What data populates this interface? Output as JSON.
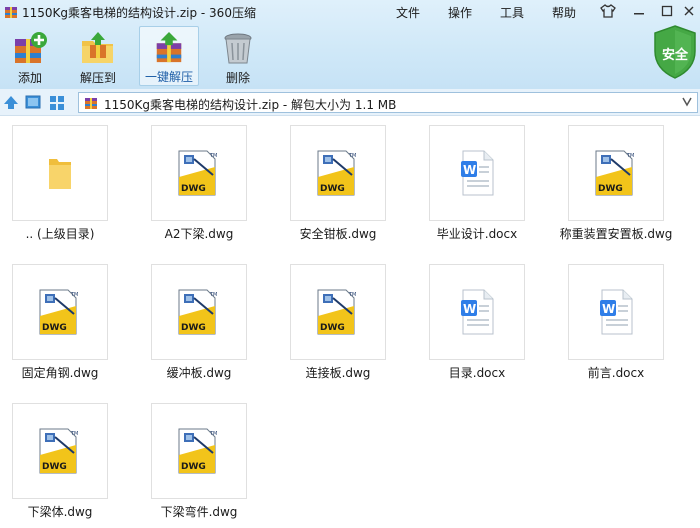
{
  "window": {
    "title": "1150Kg乘客电梯的结构设计.zip - 360压缩",
    "menus": [
      "文件",
      "操作",
      "工具",
      "帮助"
    ]
  },
  "toolbar": {
    "buttons": [
      {
        "label": "添加",
        "icon": "add-archive-icon"
      },
      {
        "label": "解压到",
        "icon": "extract-to-icon"
      },
      {
        "label": "一键解压",
        "icon": "one-click-extract-icon",
        "active": true
      },
      {
        "label": "删除",
        "icon": "trash-can-icon"
      }
    ],
    "security_badge": "安全"
  },
  "address": {
    "path": "1150Kg乘客电梯的结构设计.zip - 解包大小为 1.1 MB"
  },
  "files": [
    {
      "name": ".. (上级目录)",
      "type": "folder"
    },
    {
      "name": "A2下梁.dwg",
      "type": "dwg"
    },
    {
      "name": "安全钳板.dwg",
      "type": "dwg"
    },
    {
      "name": "毕业设计.docx",
      "type": "docx"
    },
    {
      "name": "称重装置安置板.dwg",
      "type": "dwg"
    },
    {
      "name": "固定角钢.dwg",
      "type": "dwg"
    },
    {
      "name": "缓冲板.dwg",
      "type": "dwg"
    },
    {
      "name": "连接板.dwg",
      "type": "dwg"
    },
    {
      "name": "目录.docx",
      "type": "docx"
    },
    {
      "name": "前言.docx",
      "type": "docx"
    },
    {
      "name": "下梁体.dwg",
      "type": "dwg"
    },
    {
      "name": "下梁弯件.dwg",
      "type": "dwg"
    }
  ],
  "colors": {
    "accent": "#3a8fd8",
    "shield": "#4caf50",
    "dwg_yellow": "#f2c41a",
    "word_blue": "#2f7ee8"
  }
}
